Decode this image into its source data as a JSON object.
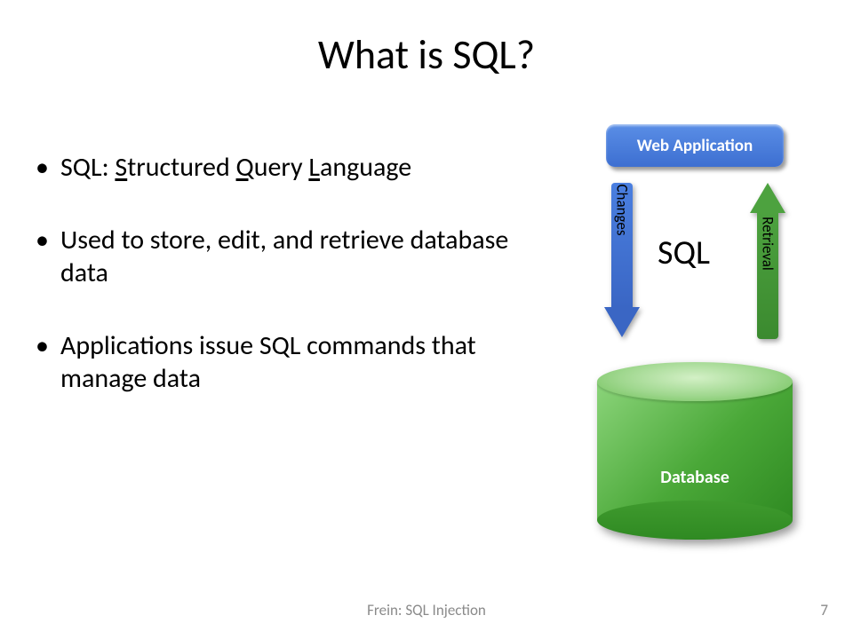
{
  "title": "What is SQL?",
  "bullets": [
    {
      "prefix": "SQL: ",
      "s": "S",
      "rest1": "tructured ",
      "q": "Q",
      "rest2": "uery ",
      "l": "L",
      "rest3": "anguage"
    },
    {
      "text": "Used to store, edit, and retrieve database data"
    },
    {
      "text": "Applications issue SQL commands that manage data"
    }
  ],
  "diagram": {
    "webapp": "Web Application",
    "sql": "SQL",
    "down_label": "Changes",
    "up_label": "Retrieval",
    "database": "Database"
  },
  "footer": {
    "source": "Frein: SQL Injection",
    "page": "7"
  }
}
